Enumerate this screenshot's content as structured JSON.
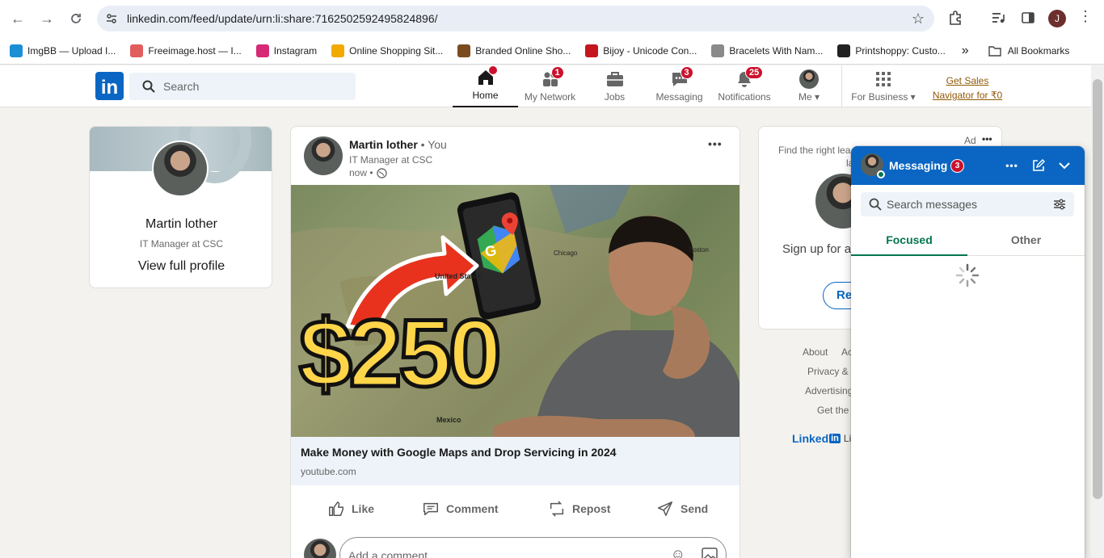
{
  "browser": {
    "url": "linkedin.com/feed/update/urn:li:share:7162502592495824896/",
    "profile_initial": "J",
    "bookmarks": [
      {
        "label": "ImgBB — Upload I...",
        "color": "#1a8fd6"
      },
      {
        "label": "Freeimage.host — I...",
        "color": "#e25d5d"
      },
      {
        "label": "Instagram",
        "color": "#d62976"
      },
      {
        "label": "Online Shopping Sit...",
        "color": "#f2a900"
      },
      {
        "label": "Branded Online Sho...",
        "color": "#7a4b1f"
      },
      {
        "label": "Bijoy - Unicode Con...",
        "color": "#c4161c"
      },
      {
        "label": "Bracelets With Nam...",
        "color": "#8a8a8a"
      },
      {
        "label": "Printshoppy: Custo...",
        "color": "#222222"
      }
    ],
    "bookmarks_overflow": "»",
    "all_bookmarks": "All Bookmarks"
  },
  "header": {
    "logo": "in",
    "search_placeholder": "Search",
    "nav": [
      {
        "label": "Home",
        "badge": "",
        "dot": true,
        "active": true
      },
      {
        "label": "My Network",
        "badge": "1",
        "dot": false,
        "active": false
      },
      {
        "label": "Jobs",
        "badge": "",
        "dot": false,
        "active": false
      },
      {
        "label": "Messaging",
        "badge": "3",
        "dot": false,
        "active": false
      },
      {
        "label": "Notifications",
        "badge": "25",
        "dot": false,
        "active": false
      }
    ],
    "me_label": "Me ▾",
    "business_label": "For Business ▾",
    "sales_line1": "Get Sales",
    "sales_line2": "Navigator for ₹0"
  },
  "profile_card": {
    "name": "Martin lother",
    "title": "IT Manager at CSC",
    "link": "View full profile"
  },
  "post": {
    "author": "Martin lother",
    "you": "• You",
    "headline": "IT Manager at CSC",
    "time": "now •",
    "more": "•••",
    "image_text": "$250",
    "map_labels": [
      "United States",
      "Mexico",
      "Chicago",
      "Boston"
    ],
    "link_title": "Make Money with Google Maps and Drop Servicing in 2024",
    "link_domain": "youtube.com",
    "actions": [
      "Like",
      "Comment",
      "Repost",
      "Send"
    ],
    "comment_placeholder": "Add a comment..."
  },
  "ad_card": {
    "ad_label": "Ad",
    "more": "•••",
    "text_line1": "Find the right lea",
    "text_line2": "la",
    "signup": "Sign up for a",
    "button": "Re"
  },
  "footer": {
    "links": [
      "About",
      "Ac",
      "Privacy &",
      "Advertising",
      "Get the"
    ],
    "brand": "Linked",
    "brand_in": "in",
    "brand_suffix": "Lin"
  },
  "messaging": {
    "title": "Messaging",
    "badge": "3",
    "search_placeholder": "Search messages",
    "tabs": [
      "Focused",
      "Other"
    ]
  }
}
